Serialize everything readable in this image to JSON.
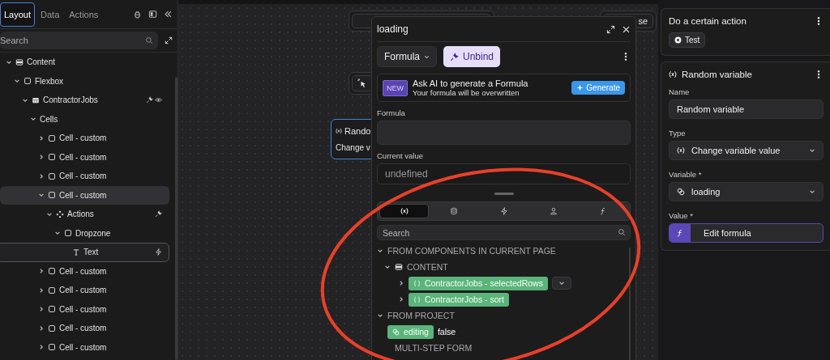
{
  "left_panel": {
    "tabs": [
      {
        "label": "Layout",
        "selected": true
      },
      {
        "label": "Data",
        "selected": false
      },
      {
        "label": "Actions",
        "selected": false
      }
    ],
    "search": {
      "placeholder": "Search"
    },
    "tree": [
      {
        "label": "Content",
        "kind": "section",
        "expanded": true,
        "selected": false,
        "highlighted": false,
        "children": [
          {
            "label": "Flexbox",
            "kind": "box",
            "expanded": true,
            "selected": false,
            "highlighted": false,
            "children": [
              {
                "label": "ContractorJobs",
                "kind": "table",
                "expanded": true,
                "selected": false,
                "highlighted": false,
                "trailing": [
                  {
                    "kind": "plug"
                  },
                  {
                    "kind": "eye"
                  }
                ],
                "children": [
                  {
                    "label": "Cells",
                    "expanded": true,
                    "selected": false,
                    "highlighted": false,
                    "children": [
                      {
                        "label": "Cell - custom",
                        "kind": "box",
                        "expanded": false,
                        "selected": false,
                        "highlighted": false
                      },
                      {
                        "label": "Cell - custom",
                        "kind": "box",
                        "expanded": false,
                        "selected": false,
                        "highlighted": false
                      },
                      {
                        "label": "Cell - custom",
                        "kind": "box",
                        "expanded": false,
                        "selected": false,
                        "highlighted": false
                      },
                      {
                        "label": "Cell - custom",
                        "kind": "box",
                        "expanded": true,
                        "selected": false,
                        "highlighted": true,
                        "children": [
                          {
                            "label": "Actions",
                            "kind": "action",
                            "expanded": true,
                            "selected": false,
                            "highlighted": false,
                            "trailing": [
                              {
                                "kind": "plug"
                              }
                            ],
                            "children": [
                              {
                                "label": "Dropzone",
                                "kind": "box",
                                "expanded": true,
                                "selected": false,
                                "highlighted": false,
                                "children": [
                                  {
                                    "label": "Text",
                                    "kind": "text",
                                    "selected": true,
                                    "highlighted": false,
                                    "trailing": [
                                      {
                                        "kind": "bolt"
                                      }
                                    ]
                                  }
                                ]
                              }
                            ]
                          }
                        ]
                      },
                      {
                        "label": "Cell - custom",
                        "kind": "box",
                        "expanded": false,
                        "selected": false,
                        "highlighted": false
                      },
                      {
                        "label": "Cell - custom",
                        "kind": "box",
                        "expanded": false,
                        "selected": false,
                        "highlighted": false
                      },
                      {
                        "label": "Cell - custom",
                        "kind": "box",
                        "expanded": false,
                        "selected": false,
                        "highlighted": false
                      },
                      {
                        "label": "Cell - custom",
                        "kind": "box",
                        "expanded": false,
                        "selected": false,
                        "highlighted": false
                      },
                      {
                        "label": "Cell - custom",
                        "kind": "box",
                        "expanded": false,
                        "selected": false,
                        "highlighted": false
                      }
                    ]
                  }
                ]
              }
            ]
          }
        ]
      }
    ]
  },
  "canvas": {
    "nodes": [
      {
        "kind": "empty",
        "selected": false
      },
      {
        "kind": "text",
        "title": "se",
        "selected": false
      },
      {
        "kind": "trigger",
        "selected": false
      },
      {
        "kind": "variable",
        "title": "Rando",
        "subtitle": "Change v",
        "selected": true
      }
    ]
  },
  "formula_popup": {
    "title": "loading",
    "mode": {
      "label": "Formula"
    },
    "unbind": {
      "label": "Unbind"
    },
    "ai_banner": {
      "badge": "NEW",
      "title": "Ask AI to generate a Formula",
      "subtitle": "Your formula will be overwritten",
      "button": "Generate"
    },
    "formula_label": "Formula",
    "current_value": {
      "label": "Current value",
      "value": "undefined"
    },
    "source_tabs": [
      {
        "kind": "variables",
        "selected": true
      },
      {
        "kind": "database",
        "selected": false
      },
      {
        "kind": "bolt",
        "selected": false
      },
      {
        "kind": "user",
        "selected": false
      },
      {
        "kind": "function",
        "selected": false
      }
    ],
    "search": {
      "placeholder": "Search"
    },
    "tree": [
      {
        "kind": "group",
        "label": "FROM COMPONENTS IN CURRENT PAGE",
        "expanded": true,
        "children": [
          {
            "kind": "section",
            "label": "CONTENT",
            "expanded": true,
            "children": [
              {
                "kind": "object",
                "label": "ContractorJobs - selectedRows",
                "expanded": false,
                "menu": true
              },
              {
                "kind": "object",
                "label": "ContractorJobs - sort",
                "expanded": false,
                "menu": false
              }
            ]
          }
        ]
      },
      {
        "kind": "group",
        "label": "FROM PROJECT",
        "expanded": true,
        "children": [
          {
            "kind": "variable",
            "label": "editing",
            "value": "false"
          },
          {
            "kind": "group",
            "label": "MULTI-STEP FORM"
          }
        ]
      }
    ]
  },
  "right_panel": {
    "action_card": {
      "title": "Do a certain action",
      "button": {
        "label": "Test"
      }
    },
    "variable_card": {
      "title": "Random variable",
      "fields": [
        {
          "kind": "text",
          "label": "Name",
          "value": "Random variable"
        },
        {
          "kind": "select",
          "label": "Type",
          "value": "Change variable value"
        },
        {
          "kind": "variable_select",
          "label": "Variable *",
          "value": "loading"
        },
        {
          "kind": "formula",
          "label": "Value *",
          "value": "Edit formula"
        }
      ]
    }
  }
}
